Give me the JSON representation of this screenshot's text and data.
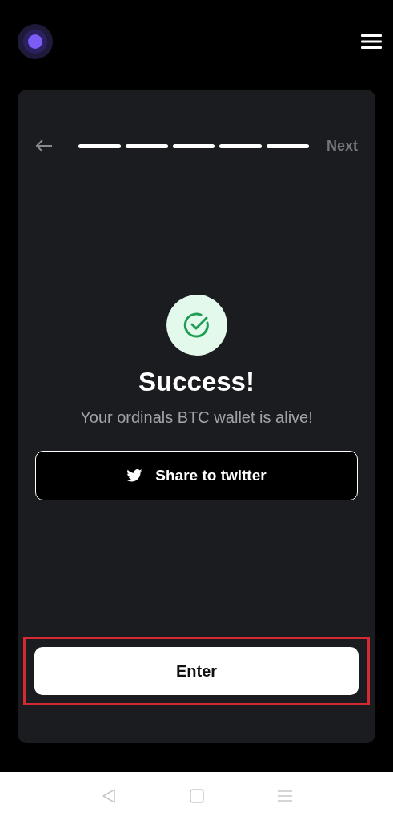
{
  "wizard": {
    "steps": [
      {
        "done": true
      },
      {
        "done": true
      },
      {
        "done": true
      },
      {
        "done": true
      },
      {
        "done": true
      }
    ],
    "next": {
      "label": "Next",
      "disabled": true
    }
  },
  "result": {
    "title": "Success!",
    "message": "Your ordinals BTC wallet is alive!"
  },
  "share_button": {
    "label": "Share to twitter"
  },
  "enter_button": {
    "label": "Enter",
    "highlighted": true
  }
}
